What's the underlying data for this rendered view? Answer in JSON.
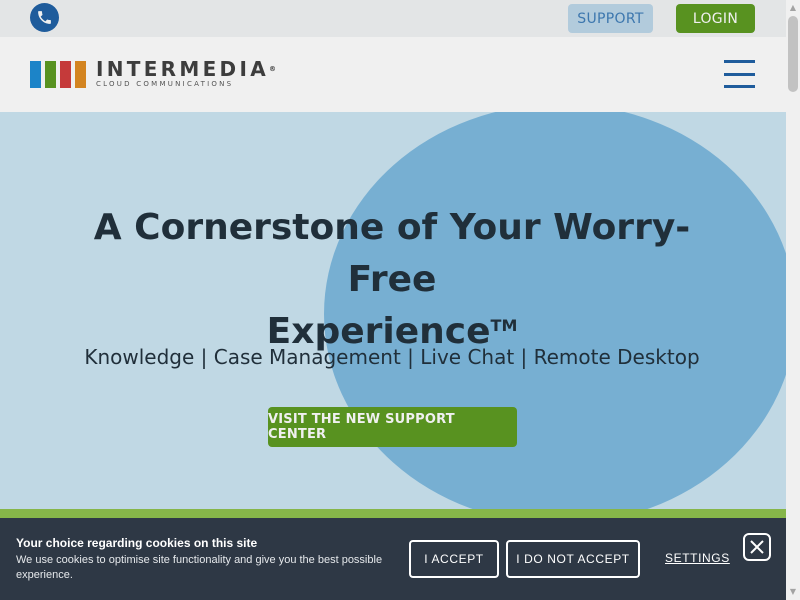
{
  "topbar": {
    "phone_icon": "phone-icon",
    "support_label": "SUPPORT",
    "login_label": "LOGIN"
  },
  "navbar": {
    "logo_name": "INTERMEDIA",
    "logo_mark": "®",
    "logo_tagline": "CLOUD COMMUNICATIONS",
    "logo_bar_colors": [
      "#1a8ad4",
      "#5b9a1e",
      "#d13a3a",
      "#e08a1e"
    ],
    "menu_icon": "hamburger-menu-icon"
  },
  "hero": {
    "title_line1": "A Cornerstone of Your Worry-Free",
    "title_line2": "Experience",
    "title_tm": "TM",
    "subtitle": "Knowledge | Case Management | Live Chat | Remote Desktop",
    "cta_label": "VISIT THE NEW SUPPORT CENTER"
  },
  "cookie_banner": {
    "title": "Your choice regarding cookies on this site",
    "text": "We use cookies to optimise site functionality and give you the best possible experience.",
    "accept_label": "I ACCEPT",
    "decline_label": "I DO NOT ACCEPT",
    "settings_label": "SETTINGS",
    "close_icon": "close-icon"
  },
  "colors": {
    "brand_blue": "#1d5fa4",
    "brand_green": "#5b9a1e",
    "hero_bg": "#cbe5f2",
    "hero_circle": "#7cb9df",
    "cookie_bg": "#2e3845"
  }
}
